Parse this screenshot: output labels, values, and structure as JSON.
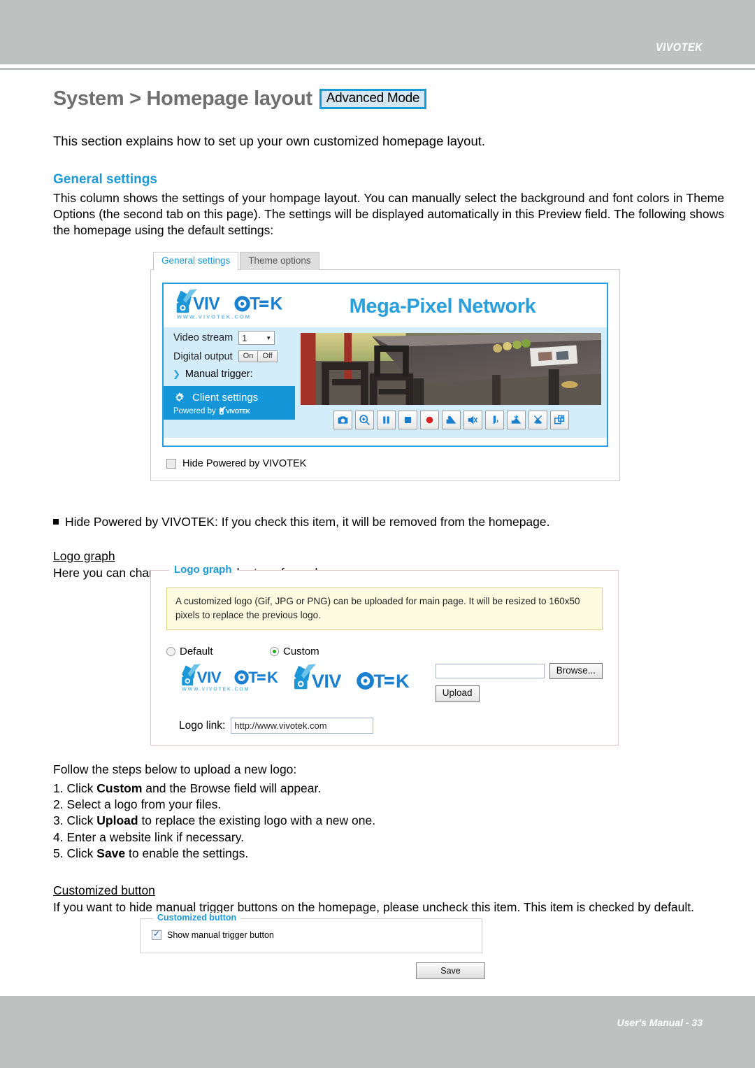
{
  "header": {
    "brand": "VIVOTEK"
  },
  "footer": {
    "text": "User's Manual - 33"
  },
  "page": {
    "title": "System > Homepage layout",
    "mode_badge": "Advanced Mode",
    "lead": "This section explains how to set up your own customized homepage layout."
  },
  "general_settings": {
    "heading": "General settings",
    "paragraph": "This column shows the settings of your hompage layout. You can manually select the background and font colors in Theme Options (the second tab on this page). The settings will be displayed automatically in this Preview field. The following shows the homepage using the default settings:"
  },
  "preview_widget": {
    "tabs": [
      {
        "label": "General settings",
        "active": true
      },
      {
        "label": "Theme options",
        "active": false
      }
    ],
    "camera": {
      "logo_text": "VIVOTEK",
      "logo_sub": "WWW.VIVOTEK.COM",
      "title": "Mega-Pixel Network",
      "video_stream_label": "Video stream",
      "video_stream_value": "1",
      "digital_output_label": "Digital output",
      "digital_output_on": "On",
      "digital_output_off": "Off",
      "manual_trigger_label": "Manual trigger:",
      "client_settings_label": "Client settings",
      "powered_by_label": "Powered by",
      "powered_by_brand": "VIVOTEK",
      "toolbar_icons": [
        "snapshot-camera-icon",
        "digital-zoom-icon",
        "pause-icon",
        "stop-icon",
        "record-icon",
        "volume-on-icon",
        "volume-mute-icon",
        "talk-icon",
        "mic-on-icon",
        "mic-mute-icon",
        "fullscreen-icon"
      ]
    },
    "hide_powered_label": "Hide Powered by VIVOTEK",
    "hide_powered_checked": false
  },
  "hide_powered_bullet": "Hide Powered by VIVOTEK: If you check this item, it will be removed from the homepage.",
  "logo_graph": {
    "heading": "Logo graph",
    "description": "Here you can change the logo at the top of your homepage.",
    "legend": "Logo graph",
    "note": "A customized logo (Gif, JPG or PNG) can be uploaded for main page. It will be resized to 160x50 pixels to replace the previous logo.",
    "radio_default": "Default",
    "radio_custom": "Custom",
    "selected_radio": "Custom",
    "browse_button": "Browse...",
    "upload_button": "Upload",
    "file_field_value": "",
    "logo_link_label": "Logo link:",
    "logo_link_value": "http://www.vivotek.com",
    "default_logo_text": "VIVOTEK",
    "default_logo_sub": "WWW.VIVOTEK.COM",
    "custom_logo_text": "VIVOTEK"
  },
  "upload_steps": {
    "intro": "Follow the steps below to upload a new logo:",
    "items": [
      {
        "num": "1.",
        "pre": "Click ",
        "bold": "Custom",
        "post": " and the Browse field will appear."
      },
      {
        "num": "2.",
        "pre": "Select a logo from your files.",
        "bold": "",
        "post": ""
      },
      {
        "num": "3.",
        "pre": "Click ",
        "bold": "Upload",
        "post": " to replace the existing logo with a new one."
      },
      {
        "num": "4.",
        "pre": "Enter a website link if necessary.",
        "bold": "",
        "post": ""
      },
      {
        "num": "5.",
        "pre": "Click ",
        "bold": "Save",
        "post": " to enable the settings."
      }
    ]
  },
  "customized_button": {
    "heading": "Customized button",
    "description": "If you want to hide manual trigger buttons on the homepage, please uncheck this item. This item is checked by default.",
    "legend": "Customized button",
    "checkbox_label": "Show manual trigger button",
    "checkbox_checked": true,
    "save_button": "Save"
  },
  "colors": {
    "brand_blue": "#1c9ad6",
    "camera_panel_blue": "#d4edfb",
    "client_settings_blue": "#1596d8",
    "header_grey": "#bfc1c1",
    "note_yellow": "#fefce0"
  }
}
